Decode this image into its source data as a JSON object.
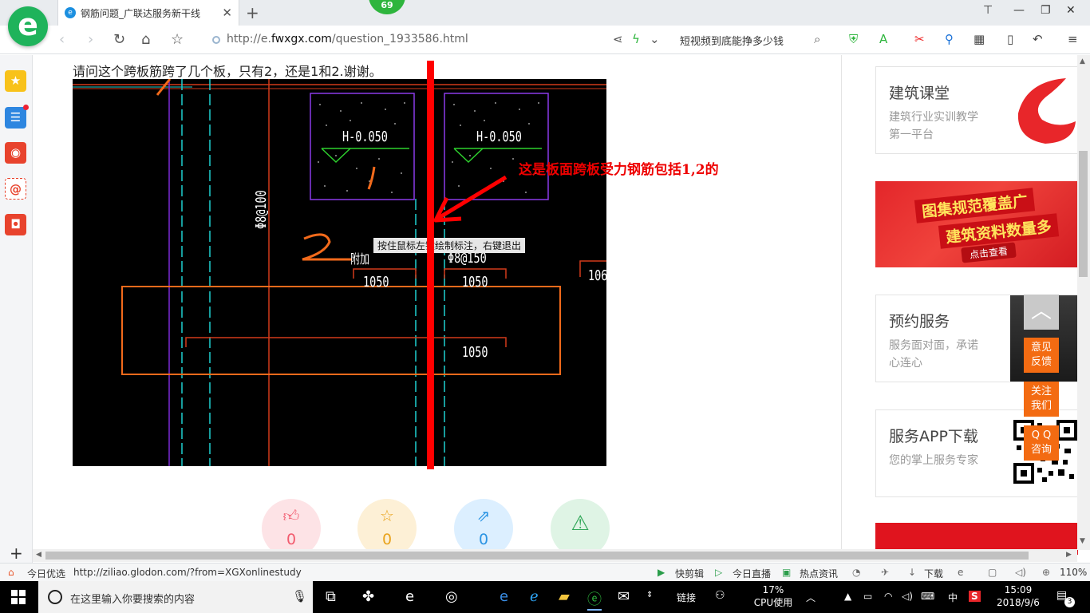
{
  "browser": {
    "badge": "69",
    "tab_title": "钢筋问题_广联达服务新干线",
    "url_prefix": "http://e.",
    "url_domain": "fwxgx.com",
    "url_path": "/question_1933586.html",
    "search_text": "短视频到底能挣多少钱"
  },
  "content": {
    "question": "请问这个跨板筋跨了几个板，只有2，还是1和2.谢谢。",
    "annotation": "这是板面跨板受力钢筋包括1,2的",
    "cad": {
      "labels": {
        "h1": "H-0.050",
        "h2": "H-0.050",
        "rebar_left": "Φ8@100",
        "rebar_mid": "Φ8@150",
        "addl": "附加",
        "dim1": "1050",
        "dim2": "1050",
        "dim3": "1050",
        "dim_right": "106",
        "mark1": "1",
        "mark2": "2"
      },
      "hint": "按住鼠标左键绘制标注，右键退出"
    },
    "reactions": [
      {
        "name": "like",
        "count": "0",
        "color": "#f25b6e",
        "bg": "#fde3e6",
        "icon": "thumbs-up-icon"
      },
      {
        "name": "favorite",
        "count": "0",
        "color": "#e9a31c",
        "bg": "#fdf0d6",
        "icon": "star-icon"
      },
      {
        "name": "share",
        "count": "0",
        "color": "#2b94e3",
        "bg": "#dcefff",
        "icon": "share-icon"
      },
      {
        "name": "report",
        "count": "",
        "color": "#33a85a",
        "bg": "#dff4e5",
        "icon": "warning-icon"
      }
    ]
  },
  "sidebar_right": {
    "course": {
      "title": "建筑课堂",
      "sub": "建筑行业实训教学第一平台"
    },
    "banner": {
      "line1": "图集规范覆盖广",
      "line2": "建筑资料数量多",
      "button": "点击查看"
    },
    "reserve": {
      "title": "预约服务",
      "sub": "服务面对面，承诺心连心"
    },
    "app": {
      "title": "服务APP下载",
      "sub": "您的掌上服务专家"
    }
  },
  "float_buttons": {
    "feedback": "意见\n反馈",
    "follow": "关注\n我们",
    "qq": "Q Q\n咨询"
  },
  "statusbar": {
    "left_label": "今日优选",
    "link": "http://ziliao.glodon.com/?from=XGXonlinestudy",
    "quick_clip": "快剪辑",
    "live": "今日直播",
    "news": "热点资讯",
    "download": "下载",
    "zoom": "110%"
  },
  "taskbar": {
    "search_placeholder": "在这里输入你要搜索的内容",
    "link_label": "链接",
    "cpu_percent": "17%",
    "cpu_label": "CPU使用",
    "ime": "中",
    "time": "15:09",
    "date": "2018/9/6",
    "notifications": "3"
  }
}
